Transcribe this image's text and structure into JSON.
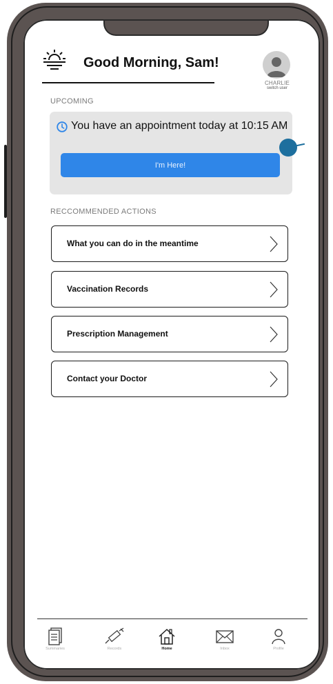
{
  "header": {
    "greeting": "Good Morning, Sam!",
    "user_name": "CHARLIE",
    "switch_user": "switch user"
  },
  "upcoming": {
    "section_label": "UPCOMING",
    "appointment_text": "You have an appointment today at 10:15 AM",
    "checkin_button": "I'm Here!",
    "accent_color": "#2f86e8"
  },
  "recommended": {
    "section_label": "RECCOMMENDED ACTIONS",
    "items": [
      {
        "label": "What you can do in the meantime"
      },
      {
        "label": "Vaccination Records"
      },
      {
        "label": "Prescription Management"
      },
      {
        "label": "Contact your Doctor"
      }
    ]
  },
  "nav": {
    "items": [
      {
        "label": "Summaries",
        "icon": "document-icon",
        "active": false
      },
      {
        "label": "Records",
        "icon": "syringe-icon",
        "active": false
      },
      {
        "label": "Home",
        "icon": "home-icon",
        "active": true
      },
      {
        "label": "Inbox",
        "icon": "envelope-icon",
        "active": false
      },
      {
        "label": "Profile",
        "icon": "user-icon",
        "active": false
      }
    ]
  }
}
